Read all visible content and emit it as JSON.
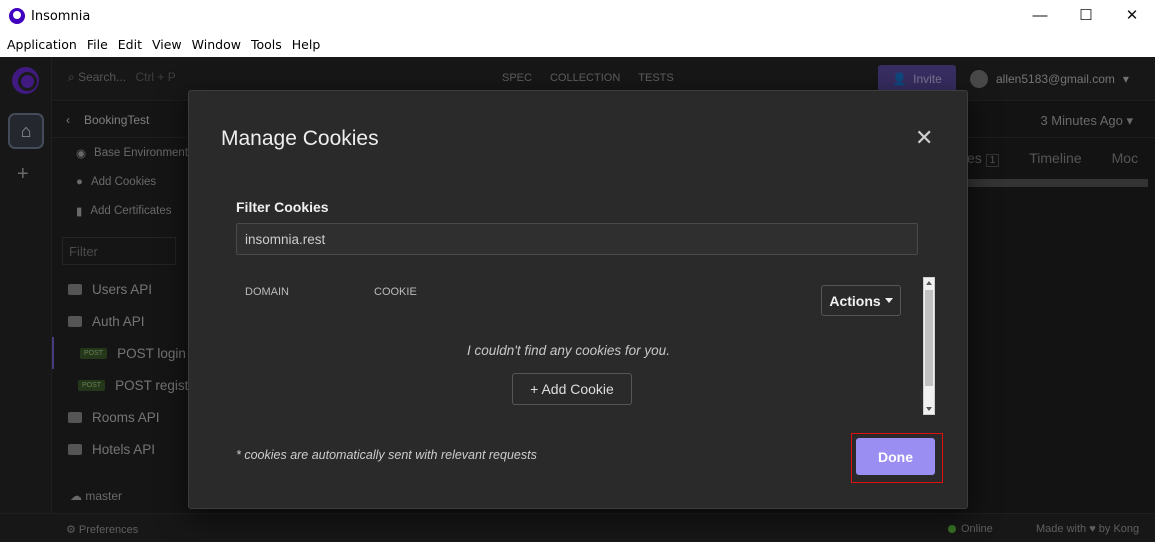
{
  "window": {
    "title": "Insomnia",
    "controls": {
      "minimize": "—",
      "maximize": "☐",
      "close": "✕"
    }
  },
  "menubar": [
    "Application",
    "File",
    "Edit",
    "View",
    "Window",
    "Tools",
    "Help"
  ],
  "topbar": {
    "search_placeholder": "Search...",
    "search_shortcut": "Ctrl + P",
    "tabs": [
      "SPEC",
      "COLLECTION",
      "TESTS"
    ],
    "invite_label": "Invite",
    "user_email": "allen5183@gmail.com"
  },
  "sidebar": {
    "project": "BookingTest",
    "links": [
      "Base Environment",
      "Add Cookies",
      "Add Certificates"
    ],
    "filter_placeholder": "Filter",
    "items": [
      {
        "type": "folder",
        "label": "Users API"
      },
      {
        "type": "folder",
        "label": "Auth API"
      },
      {
        "type": "request",
        "method": "POST",
        "label": "POST login"
      },
      {
        "type": "request",
        "method": "POST",
        "label": "POST regist"
      },
      {
        "type": "folder",
        "label": "Rooms API"
      },
      {
        "type": "folder",
        "label": "Hotels API"
      }
    ],
    "branch": "master"
  },
  "rightpane": {
    "time_label": "3 Minutes Ago",
    "tabs": [
      "es",
      "Timeline",
      "Moc"
    ],
    "badge": "1"
  },
  "statusbar": {
    "preferences": "Preferences",
    "online": "Online",
    "made_with": "Made with ♥ by Kong"
  },
  "modal": {
    "title": "Manage Cookies",
    "close_glyph": "✕",
    "filter_label": "Filter Cookies",
    "filter_value": "insomnia.rest",
    "columns": [
      "DOMAIN",
      "COOKIE"
    ],
    "actions_label": "Actions",
    "empty_message": "I couldn't find any cookies for you.",
    "add_cookie_label": "+ Add Cookie",
    "footnote": "* cookies are automatically sent with relevant requests",
    "done_label": "Done"
  },
  "colors": {
    "accent": "#9b8ef3",
    "highlight_outline": "#e01010",
    "app_bg": "#1c1c1c",
    "modal_bg": "#2a2a2a"
  }
}
